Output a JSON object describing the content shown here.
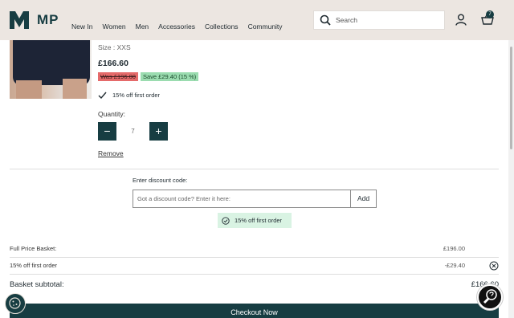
{
  "header": {
    "logo_text": "MP",
    "nav": [
      "New In",
      "Women",
      "Men",
      "Accessories",
      "Collections",
      "Community"
    ],
    "search_placeholder": "Search",
    "basket_count": "7"
  },
  "product": {
    "size": "Size : XXS",
    "price": "£166.60",
    "was": "Was £196.00",
    "save": "Save £29.40 (15 %)",
    "promo": "15% off first order",
    "quantity_label": "Quantity:",
    "quantity_value": "7",
    "minus_label": "−",
    "plus_label": "+",
    "remove_label": "Remove"
  },
  "discount": {
    "label": "Enter discount code:",
    "placeholder": "Got a discount code? Enter it here:",
    "add_label": "Add",
    "applied_text": "15% off first order"
  },
  "summary": {
    "rows": [
      {
        "label": "Full Price Basket:",
        "value": "£196.00"
      },
      {
        "label": "15% off first order",
        "value": "-£29.40"
      }
    ],
    "subtotal_label": "Basket subtotal:",
    "subtotal_value": "£166.60"
  },
  "checkout_label": "Checkout Now",
  "colors": {
    "brand": "#173d42",
    "header_bg": "#ece6e1",
    "was_badge": "#e56a6a",
    "save_badge": "#9bdcb0",
    "applied_bg": "#d9f3e3"
  },
  "icons": [
    "logo-mark-icon",
    "search-icon",
    "account-icon",
    "basket-icon",
    "check-icon",
    "check-circle-icon",
    "close-circle-icon",
    "cookie-icon",
    "help-icon"
  ]
}
